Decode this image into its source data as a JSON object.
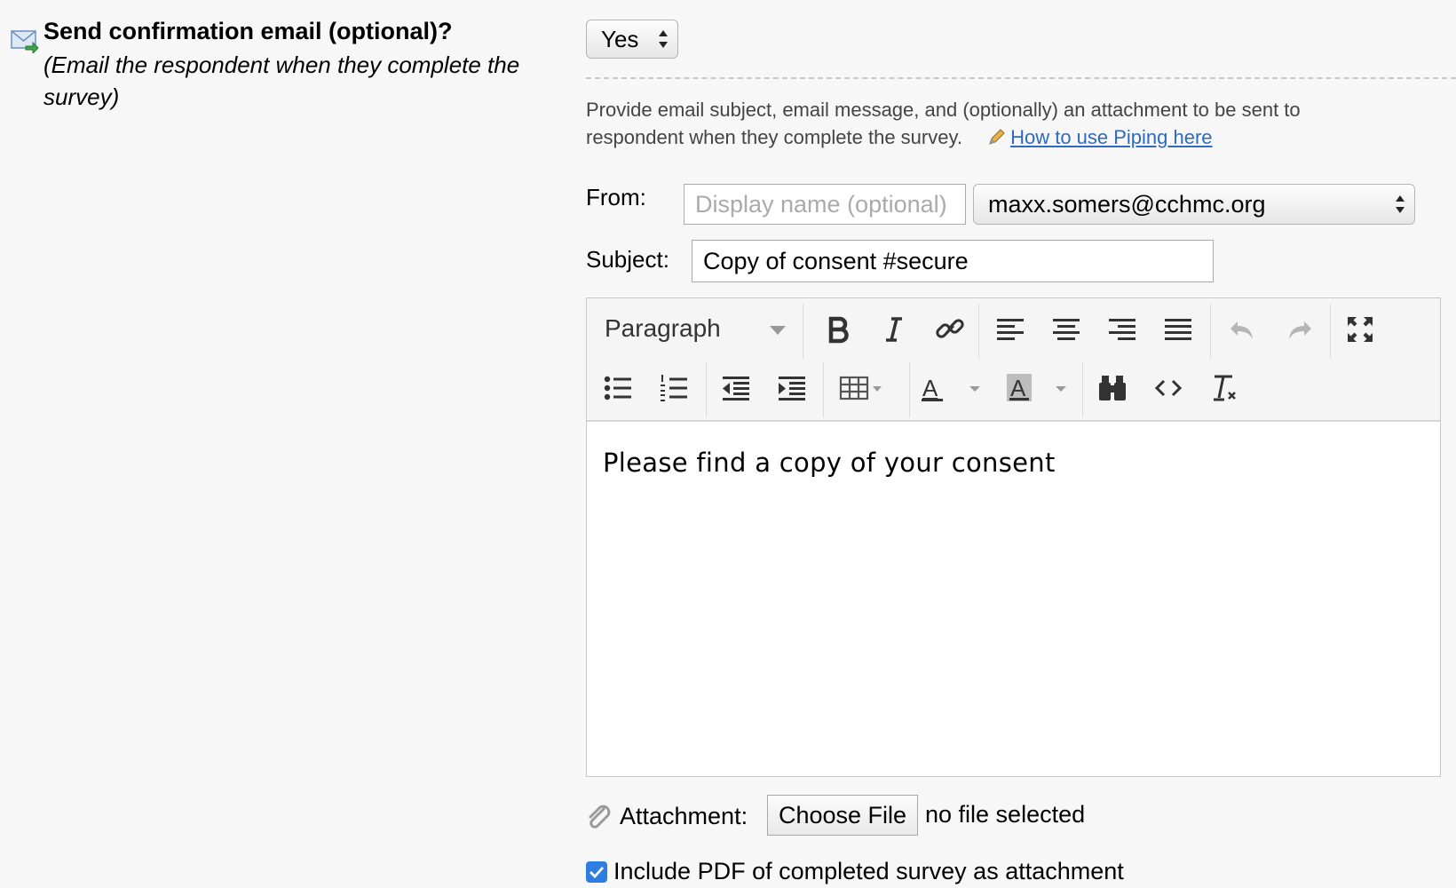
{
  "question": {
    "title": "Send confirmation email (optional)?",
    "subtitle": "(Email the respondent when they complete the survey)",
    "enabled_value": "Yes"
  },
  "description": {
    "text": "Provide email subject, email message, and (optionally) an attachment to be sent to respondent when they complete the survey.",
    "link_text": "How to use Piping here"
  },
  "from": {
    "label": "From:",
    "display_name_placeholder": "Display name (optional)",
    "email_value": "maxx.somers@cchmc.org"
  },
  "subject": {
    "label": "Subject:",
    "value": "Copy of consent #secure"
  },
  "editor": {
    "format_value": "Paragraph",
    "body_text": "Please find a copy of your consent"
  },
  "attachment": {
    "label": "Attachment:",
    "button_label": "Choose File",
    "status": "no file selected"
  },
  "include_pdf": {
    "checked": true,
    "label": "Include PDF of completed survey as attachment"
  },
  "colors": {
    "link": "#2e6bc0",
    "checkbox": "#2f7de1",
    "background": "#f7f7f7"
  }
}
